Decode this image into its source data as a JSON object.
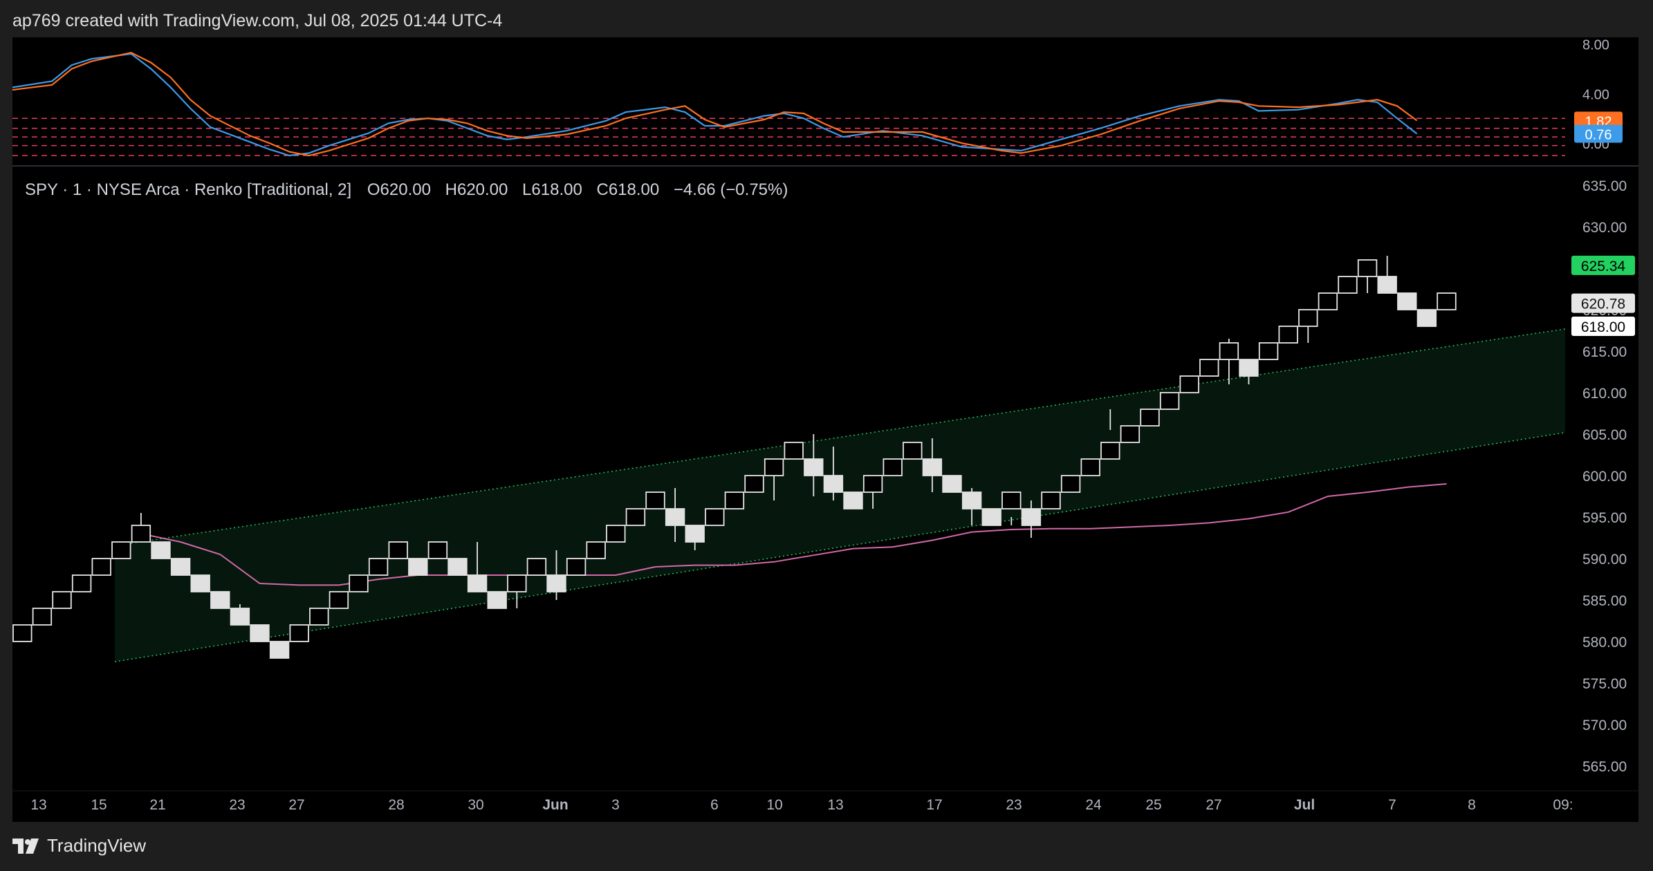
{
  "header": {
    "text": "ap769 created with TradingView.com, Jul 08, 2025 01:44 UTC-4"
  },
  "footer": {
    "brand": "TradingView"
  },
  "colors": {
    "background": "#000000",
    "frame": "#1e1e1e",
    "stoch_k": "#3d9be9",
    "stoch_d": "#ff7020",
    "ma": "#d26aa8",
    "channel": "#22c55e",
    "level": "#f03a5f",
    "up_badge": "#23d160",
    "red_badge": "#ff7020",
    "blue_badge": "#3d9be9"
  },
  "legend": {
    "symbol": "SPY · 1 · NYSE Arca · Renko [Traditional, 2]",
    "o_label": "O",
    "o": "620.00",
    "h_label": "H",
    "h": "620.00",
    "l_label": "L",
    "l": "618.00",
    "c_label": "C",
    "c": "618.00",
    "change": "−4.66 (−0.75%)"
  },
  "chart_data": [
    {
      "type": "renko",
      "title": "SPY · 1 · NYSE Arca · Renko [Traditional, 2]",
      "box_size": 2,
      "ylim": [
        562,
        637
      ],
      "yticks": [
        "635.00",
        "630.00",
        "620.00",
        "615.00",
        "610.00",
        "605.00",
        "600.00",
        "595.00",
        "590.00",
        "585.00",
        "580.00",
        "575.00",
        "570.00",
        "565.00"
      ],
      "xticks": [
        "13",
        "15",
        "21",
        "23",
        "27",
        "28",
        "30",
        "Jun",
        "3",
        "6",
        "10",
        "13",
        "17",
        "23",
        "24",
        "25",
        "27",
        "Jul",
        "7",
        "8",
        "09:"
      ],
      "bricks": [
        {
          "low": 580,
          "dir": "up"
        },
        {
          "low": 582,
          "dir": "up"
        },
        {
          "low": 584,
          "dir": "up"
        },
        {
          "low": 586,
          "dir": "up"
        },
        {
          "low": 588,
          "dir": "up"
        },
        {
          "low": 590,
          "dir": "up"
        },
        {
          "low": 592,
          "dir": "up"
        },
        {
          "low": 590,
          "dir": "down"
        },
        {
          "low": 588,
          "dir": "down"
        },
        {
          "low": 586,
          "dir": "down"
        },
        {
          "low": 584,
          "dir": "down"
        },
        {
          "low": 582,
          "dir": "down"
        },
        {
          "low": 580,
          "dir": "down"
        },
        {
          "low": 578,
          "dir": "down"
        },
        {
          "low": 580,
          "dir": "up"
        },
        {
          "low": 582,
          "dir": "up"
        },
        {
          "low": 584,
          "dir": "up"
        },
        {
          "low": 586,
          "dir": "up"
        },
        {
          "low": 588,
          "dir": "up"
        },
        {
          "low": 590,
          "dir": "up"
        },
        {
          "low": 588,
          "dir": "down"
        },
        {
          "low": 590,
          "dir": "up"
        },
        {
          "low": 588,
          "dir": "down"
        },
        {
          "low": 586,
          "dir": "down"
        },
        {
          "low": 584,
          "dir": "down"
        },
        {
          "low": 586,
          "dir": "up"
        },
        {
          "low": 588,
          "dir": "up"
        },
        {
          "low": 586,
          "dir": "down"
        },
        {
          "low": 588,
          "dir": "up"
        },
        {
          "low": 590,
          "dir": "up"
        },
        {
          "low": 592,
          "dir": "up"
        },
        {
          "low": 594,
          "dir": "up"
        },
        {
          "low": 596,
          "dir": "up"
        },
        {
          "low": 594,
          "dir": "down"
        },
        {
          "low": 592,
          "dir": "down"
        },
        {
          "low": 594,
          "dir": "up"
        },
        {
          "low": 596,
          "dir": "up"
        },
        {
          "low": 598,
          "dir": "up"
        },
        {
          "low": 600,
          "dir": "up"
        },
        {
          "low": 602,
          "dir": "up"
        },
        {
          "low": 600,
          "dir": "down"
        },
        {
          "low": 598,
          "dir": "down"
        },
        {
          "low": 596,
          "dir": "down"
        },
        {
          "low": 598,
          "dir": "up"
        },
        {
          "low": 600,
          "dir": "up"
        },
        {
          "low": 602,
          "dir": "up"
        },
        {
          "low": 600,
          "dir": "down"
        },
        {
          "low": 598,
          "dir": "down"
        },
        {
          "low": 596,
          "dir": "down"
        },
        {
          "low": 594,
          "dir": "down"
        },
        {
          "low": 596,
          "dir": "up"
        },
        {
          "low": 594,
          "dir": "down"
        },
        {
          "low": 596,
          "dir": "up"
        },
        {
          "low": 598,
          "dir": "up"
        },
        {
          "low": 600,
          "dir": "up"
        },
        {
          "low": 602,
          "dir": "up"
        },
        {
          "low": 604,
          "dir": "up"
        },
        {
          "low": 606,
          "dir": "up"
        },
        {
          "low": 608,
          "dir": "up"
        },
        {
          "low": 610,
          "dir": "up"
        },
        {
          "low": 612,
          "dir": "up"
        },
        {
          "low": 614,
          "dir": "up"
        },
        {
          "low": 612,
          "dir": "down"
        },
        {
          "low": 614,
          "dir": "up"
        },
        {
          "low": 616,
          "dir": "up"
        },
        {
          "low": 618,
          "dir": "up"
        },
        {
          "low": 620,
          "dir": "up"
        },
        {
          "low": 622,
          "dir": "up"
        },
        {
          "low": 624,
          "dir": "up"
        },
        {
          "low": 622,
          "dir": "down"
        },
        {
          "low": 620,
          "dir": "down"
        },
        {
          "low": 618,
          "dir": "down"
        },
        {
          "low": 620,
          "dir": "up"
        }
      ],
      "wicks": [
        {
          "brick": 6,
          "low": 593,
          "high": 595.5
        },
        {
          "brick": 11,
          "low": 582,
          "high": 584.5
        },
        {
          "brick": 23,
          "low": 587.5,
          "high": 592
        },
        {
          "brick": 25,
          "low": 584,
          "high": 586
        },
        {
          "brick": 27,
          "low": 585,
          "high": 591
        },
        {
          "brick": 33,
          "low": 592,
          "high": 598.5
        },
        {
          "brick": 34,
          "low": 591,
          "high": 594
        },
        {
          "brick": 38,
          "low": 597,
          "high": 600
        },
        {
          "brick": 40,
          "low": 597.5,
          "high": 605
        },
        {
          "brick": 41,
          "low": 597,
          "high": 603.5
        },
        {
          "brick": 43,
          "low": 596,
          "high": 598
        },
        {
          "brick": 46,
          "low": 598,
          "high": 604.5
        },
        {
          "brick": 48,
          "low": 594,
          "high": 598.5
        },
        {
          "brick": 50,
          "low": 594,
          "high": 595
        },
        {
          "brick": 51,
          "low": 592.5,
          "high": 597
        },
        {
          "brick": 55,
          "low": 605.5,
          "high": 608
        },
        {
          "brick": 61,
          "low": 611,
          "high": 616.5
        },
        {
          "brick": 62,
          "low": 611,
          "high": 614
        },
        {
          "brick": 65,
          "low": 616,
          "high": 620
        },
        {
          "brick": 68,
          "low": 622,
          "high": 626
        },
        {
          "brick": 69,
          "low": 622,
          "high": 626.5
        }
      ],
      "moving_average": [
        [
          6,
          593
        ],
        [
          8,
          592
        ],
        [
          10,
          590.5
        ],
        [
          12,
          587
        ],
        [
          14,
          586.8
        ],
        [
          16,
          586.8
        ],
        [
          18,
          587.5
        ],
        [
          20,
          588
        ],
        [
          22,
          588
        ],
        [
          24,
          588
        ],
        [
          26,
          588
        ],
        [
          28,
          588
        ],
        [
          30,
          588
        ],
        [
          32,
          589
        ],
        [
          34,
          589.2
        ],
        [
          36,
          589.2
        ],
        [
          38,
          589.6
        ],
        [
          40,
          590.4
        ],
        [
          42,
          591.2
        ],
        [
          44,
          591.4
        ],
        [
          46,
          592.2
        ],
        [
          48,
          593.2
        ],
        [
          50,
          593.5
        ],
        [
          52,
          593.6
        ],
        [
          54,
          593.6
        ],
        [
          56,
          593.8
        ],
        [
          58,
          594
        ],
        [
          60,
          594.3
        ],
        [
          62,
          594.8
        ],
        [
          64,
          595.6
        ],
        [
          66,
          597.5
        ],
        [
          68,
          598
        ],
        [
          70,
          598.6
        ],
        [
          72,
          599
        ]
      ],
      "channel": {
        "upper": [
          [
            5,
            591.5
          ],
          [
            78,
            617.5
          ]
        ],
        "lower": [
          [
            5,
            577.5
          ],
          [
            78,
            605
          ]
        ]
      },
      "price_labels": [
        {
          "value": 625.34,
          "label": "625.34",
          "style": "green"
        },
        {
          "value": 620.78,
          "label": "620.78",
          "style": "gray"
        },
        {
          "value": 618.0,
          "label": "618.00",
          "style": "white"
        }
      ]
    },
    {
      "type": "line",
      "ylim": [
        -1.5,
        8.2
      ],
      "yticks": [
        "8.00",
        "4.00",
        "0.00"
      ],
      "levels": [
        2.0,
        1.2,
        0.5,
        -0.2,
        -1.0
      ],
      "series": [
        {
          "values": [
            [
              0,
              4.5
            ],
            [
              2,
              5
            ],
            [
              3,
              6.3
            ],
            [
              4,
              6.8
            ],
            [
              6,
              7.2
            ],
            [
              7,
              6
            ],
            [
              8,
              4.5
            ],
            [
              9,
              2.8
            ],
            [
              10,
              1.3
            ],
            [
              12,
              0.1
            ],
            [
              13,
              -0.5
            ],
            [
              14,
              -1
            ],
            [
              15,
              -0.8
            ],
            [
              16,
              -0.2
            ],
            [
              18,
              0.8
            ],
            [
              19,
              1.6
            ],
            [
              20,
              1.9
            ],
            [
              21,
              2
            ],
            [
              22,
              1.8
            ],
            [
              23,
              1.2
            ],
            [
              24,
              0.6
            ],
            [
              25,
              0.3
            ],
            [
              26,
              0.5
            ],
            [
              28,
              1
            ],
            [
              30,
              1.8
            ],
            [
              31,
              2.5
            ],
            [
              33,
              2.9
            ],
            [
              34,
              2.5
            ],
            [
              35,
              1.4
            ],
            [
              36,
              1.4
            ],
            [
              38,
              2.2
            ],
            [
              39,
              2.4
            ],
            [
              40,
              2
            ],
            [
              41,
              1.2
            ],
            [
              42,
              0.5
            ],
            [
              44,
              1.0
            ],
            [
              46,
              0.6
            ],
            [
              48,
              -0.3
            ],
            [
              50,
              -0.5
            ],
            [
              51,
              -0.6
            ],
            [
              53,
              0.3
            ],
            [
              55,
              1.2
            ],
            [
              57,
              2.2
            ],
            [
              59,
              3
            ],
            [
              61,
              3.5
            ],
            [
              62,
              3.4
            ],
            [
              63,
              2.6
            ],
            [
              65,
              2.7
            ],
            [
              67,
              3.2
            ],
            [
              68,
              3.5
            ],
            [
              69,
              3.3
            ],
            [
              70,
              2
            ],
            [
              71,
              0.76
            ]
          ]
        },
        {
          "values": [
            [
              0,
              4.3
            ],
            [
              2,
              4.7
            ],
            [
              3,
              6
            ],
            [
              4,
              6.6
            ],
            [
              6,
              7.3
            ],
            [
              7,
              6.5
            ],
            [
              8,
              5.3
            ],
            [
              9,
              3.5
            ],
            [
              10,
              2.2
            ],
            [
              12,
              0.6
            ],
            [
              13,
              0
            ],
            [
              14,
              -0.7
            ],
            [
              15,
              -1
            ],
            [
              16,
              -0.6
            ],
            [
              18,
              0.4
            ],
            [
              19,
              1.2
            ],
            [
              20,
              1.8
            ],
            [
              21,
              2
            ],
            [
              22,
              1.9
            ],
            [
              23,
              1.6
            ],
            [
              24,
              1
            ],
            [
              25,
              0.6
            ],
            [
              26,
              0.4
            ],
            [
              28,
              0.7
            ],
            [
              30,
              1.4
            ],
            [
              31,
              2
            ],
            [
              33,
              2.7
            ],
            [
              34,
              3
            ],
            [
              35,
              1.9
            ],
            [
              36,
              1.3
            ],
            [
              38,
              1.9
            ],
            [
              39,
              2.5
            ],
            [
              40,
              2.4
            ],
            [
              41,
              1.6
            ],
            [
              42,
              0.9
            ],
            [
              44,
              0.9
            ],
            [
              46,
              0.9
            ],
            [
              48,
              0.0
            ],
            [
              50,
              -0.6
            ],
            [
              51,
              -0.8
            ],
            [
              53,
              -0.2
            ],
            [
              55,
              0.7
            ],
            [
              57,
              1.8
            ],
            [
              59,
              2.8
            ],
            [
              61,
              3.4
            ],
            [
              62,
              3.3
            ],
            [
              63,
              3.0
            ],
            [
              65,
              2.9
            ],
            [
              67,
              3.1
            ],
            [
              68,
              3.3
            ],
            [
              69,
              3.5
            ],
            [
              70,
              3
            ],
            [
              71,
              1.82
            ]
          ]
        }
      ],
      "value_labels": [
        {
          "value": 1.82,
          "label": "1.82",
          "style": "orange"
        },
        {
          "value": 0.76,
          "label": "0.76",
          "style": "blue"
        }
      ]
    }
  ]
}
